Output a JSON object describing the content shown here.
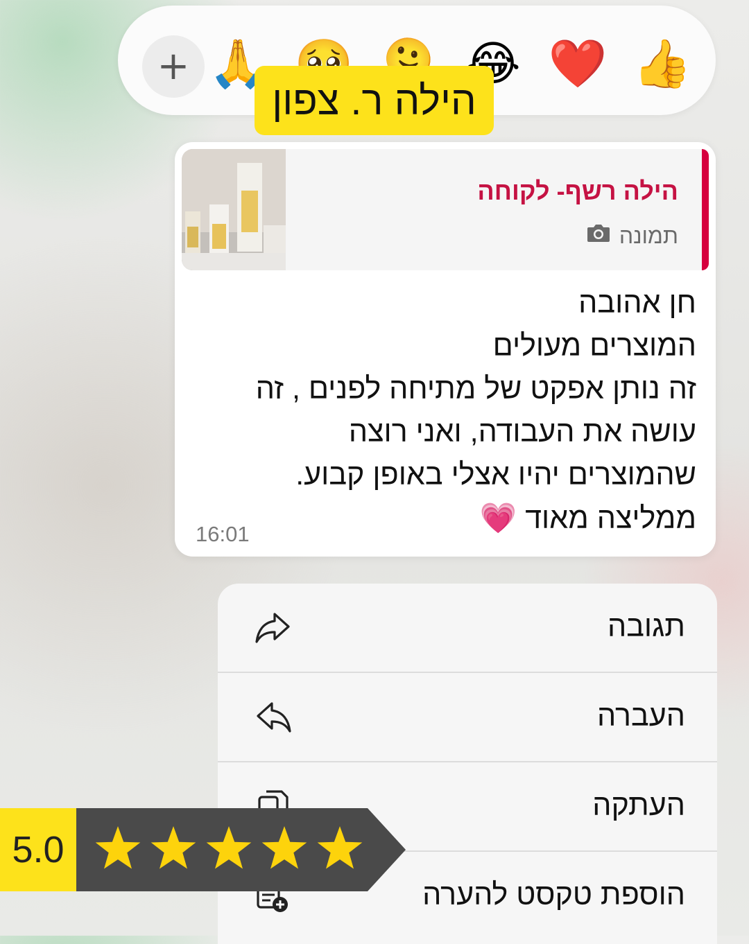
{
  "reactions": {
    "add_label": "+",
    "emojis": [
      "🙏",
      "🥹",
      "🫠",
      "😂",
      "❤️",
      "👍"
    ]
  },
  "name_tag": "הילה ר. צפון",
  "message": {
    "quote_author": "הילה רשף- לקוחה",
    "quote_type": "תמונה",
    "lines": [
      "חן אהובה",
      "המוצרים מעולים",
      "זה נותן אפקט של מתיחה לפנים , זה",
      "עושה את העבודה, ואני רוצה",
      "שהמוצרים יהיו אצלי באופן קבוע.",
      "ממליצה מאוד 💗"
    ],
    "time": "16:01"
  },
  "menu": {
    "items": [
      "תגובה",
      "העברה",
      "העתקה",
      "הוספת טקסט להערה"
    ]
  },
  "rating": {
    "score": "5.0",
    "value": 5,
    "max": 5,
    "star_color": "#fdd30c"
  },
  "colors": {
    "quote_accent": "#d6003e",
    "highlight": "#fde21b"
  }
}
